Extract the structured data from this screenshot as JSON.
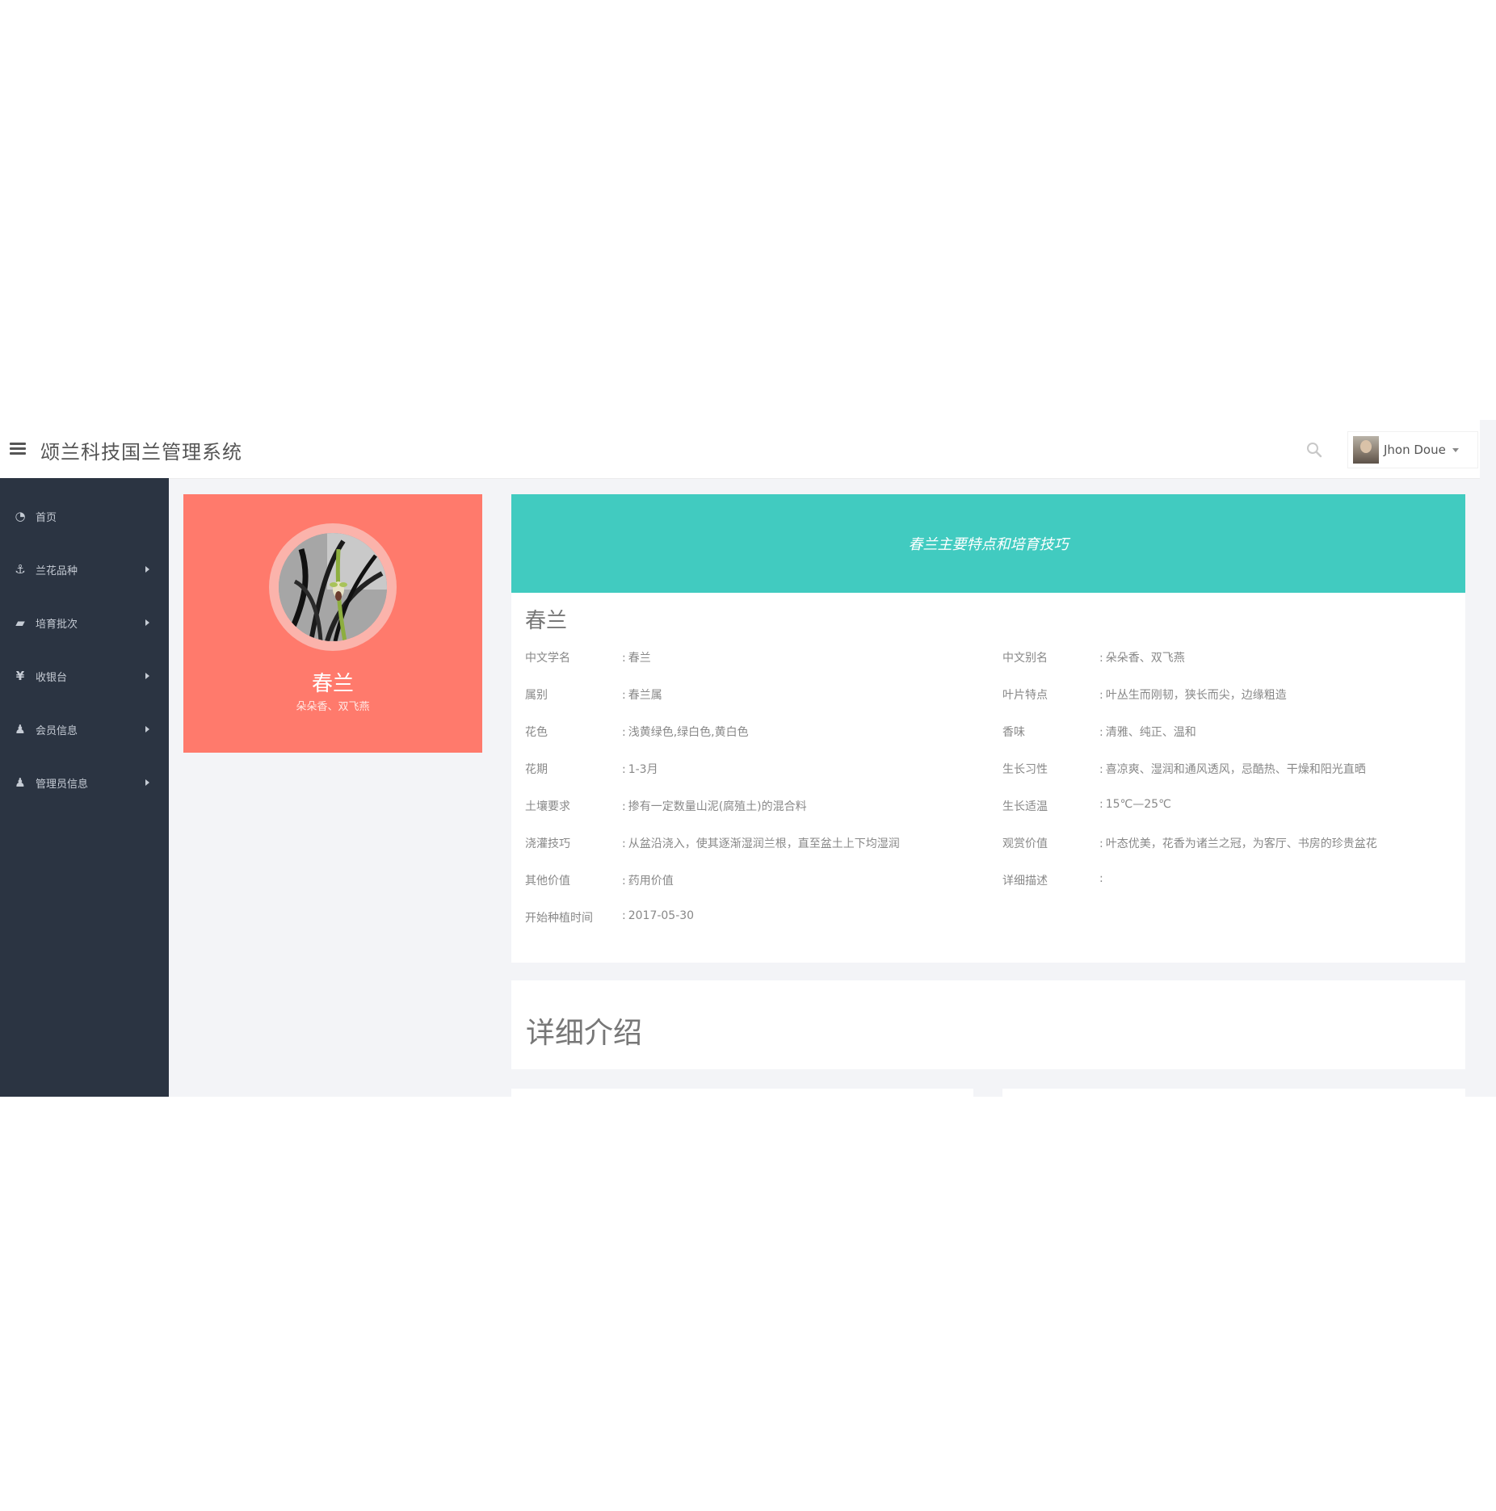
{
  "header": {
    "title": "颂兰科技国兰管理系统",
    "user_name": "Jhon Doue"
  },
  "sidebar": {
    "items": [
      {
        "label": "首页",
        "icon": "dashboard-icon",
        "glyph": "◔",
        "has_submenu": false
      },
      {
        "label": "兰花品种",
        "icon": "anchor-icon",
        "glyph": "⚓",
        "has_submenu": true
      },
      {
        "label": "培育批次",
        "icon": "book-icon",
        "glyph": "▰",
        "has_submenu": true
      },
      {
        "label": "收银台",
        "icon": "yen-icon",
        "glyph": "¥",
        "has_submenu": true
      },
      {
        "label": "会员信息",
        "icon": "users-icon",
        "glyph": "♟",
        "has_submenu": true
      },
      {
        "label": "管理员信息",
        "icon": "user-icon",
        "glyph": "♟",
        "has_submenu": true
      }
    ]
  },
  "profile": {
    "name": "春兰",
    "alias": "朵朵香、双飞燕"
  },
  "info": {
    "header": "春兰主要特点和培育技巧",
    "title": "春兰",
    "left": [
      {
        "label": "中文学名",
        "value": "春兰"
      },
      {
        "label": "属别",
        "value": "春兰属"
      },
      {
        "label": "花色",
        "value": "浅黄绿色,绿白色,黄白色"
      },
      {
        "label": "花期",
        "value": "1-3月"
      },
      {
        "label": "土壤要求",
        "value": "掺有一定数量山泥(腐殖土)的混合料"
      },
      {
        "label": "浇灌技巧",
        "value": "从盆沿浇入，使其逐渐湿润兰根，直至盆土上下均湿润"
      },
      {
        "label": "其他价值",
        "value": "药用价值"
      },
      {
        "label": "开始种植时间",
        "value": "2017-05-30"
      }
    ],
    "right": [
      {
        "label": "中文别名",
        "value": "朵朵香、双飞燕"
      },
      {
        "label": "叶片特点",
        "value": "叶丛生而刚韧，狭长而尖，边缘粗造"
      },
      {
        "label": "香味",
        "value": "清雅、纯正、温和"
      },
      {
        "label": "生长习性",
        "value": "喜凉爽、湿润和通风透风，忌酷热、干燥和阳光直晒"
      },
      {
        "label": "生长适温",
        "value": "15℃—25℃"
      },
      {
        "label": "观赏价值",
        "value": "叶态优美，花香为诸兰之冠，为客厅、书房的珍贵盆花"
      },
      {
        "label": "详细描述",
        "value": ""
      }
    ]
  },
  "detail": {
    "title": "详细介绍"
  },
  "colors": {
    "sidebar_bg": "#2b3442",
    "profile_card": "#ff7a6c",
    "info_header": "#41cbc0",
    "page_bg": "#f3f4f7"
  }
}
